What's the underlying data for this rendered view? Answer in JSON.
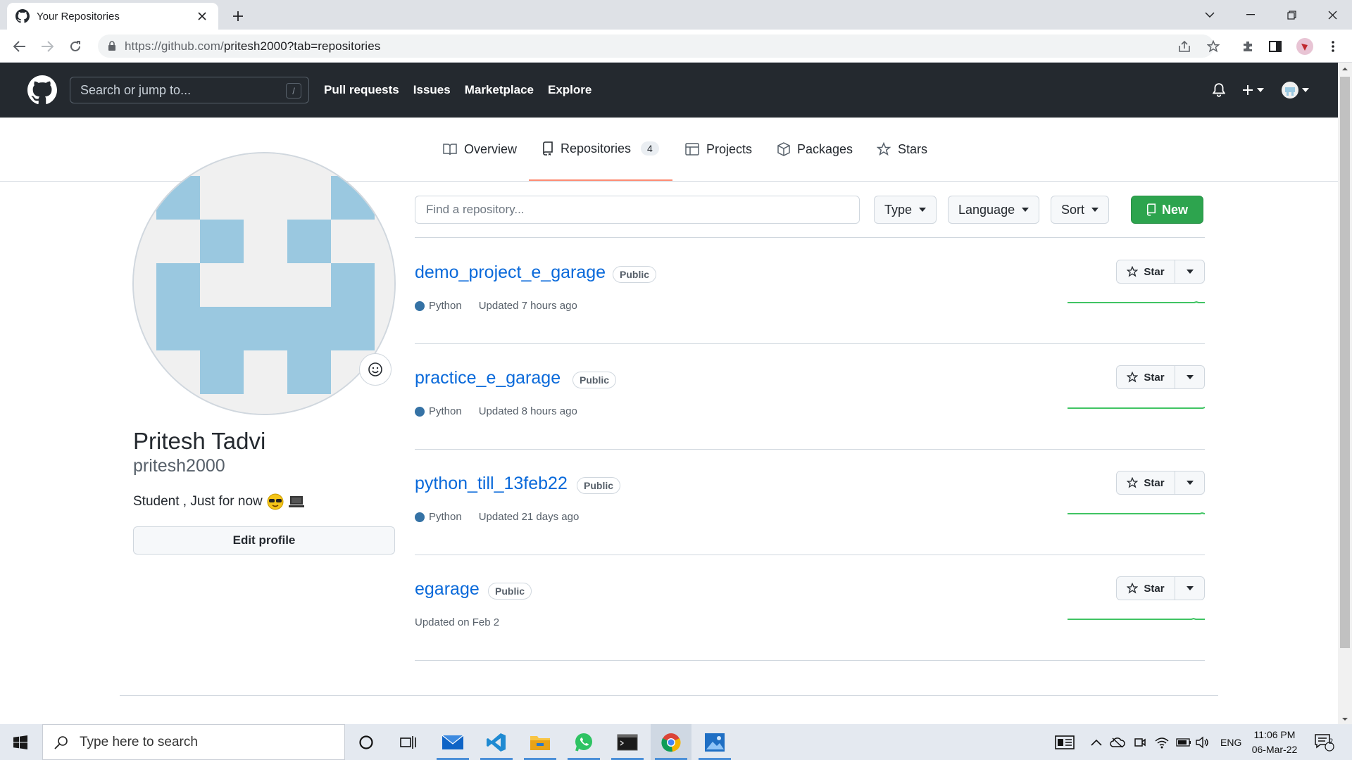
{
  "browser": {
    "tab_title": "Your Repositories",
    "url_host": "https://github.com/",
    "url_path": "pritesh2000?tab=repositories"
  },
  "header": {
    "search_placeholder": "Search or jump to...",
    "search_shortcut": "/",
    "nav": [
      "Pull requests",
      "Issues",
      "Marketplace",
      "Explore"
    ]
  },
  "profile_tabs": {
    "overview": "Overview",
    "repositories": "Repositories",
    "repositories_count": "4",
    "projects": "Projects",
    "packages": "Packages",
    "stars": "Stars"
  },
  "profile": {
    "name": "Pritesh Tadvi",
    "login": "pritesh2000",
    "bio": "Student , Just for now",
    "edit_button": "Edit profile"
  },
  "filters": {
    "find_placeholder": "Find a repository...",
    "type": "Type",
    "language": "Language",
    "sort": "Sort",
    "new": "New"
  },
  "repos": [
    {
      "name": "demo_project_e_garage",
      "visibility": "Public",
      "language": "Python",
      "updated": "Updated 7 hours ago",
      "star": "Star"
    },
    {
      "name": "practice_e_garage",
      "visibility": "Public",
      "language": "Python",
      "updated": "Updated 8 hours ago",
      "star": "Star"
    },
    {
      "name": "python_till_13feb22",
      "visibility": "Public",
      "language": "Python",
      "updated": "Updated 21 days ago",
      "star": "Star"
    },
    {
      "name": "egarage",
      "visibility": "Public",
      "language": "",
      "updated": "Updated on Feb 2",
      "star": "Star"
    }
  ],
  "colors": {
    "accent_blue": "#0969da",
    "new_green": "#2da44e",
    "python": "#3572A5",
    "tab_underline": "#fd8c73",
    "header_bg": "#24292f"
  },
  "taskbar": {
    "search_placeholder": "Type here to search",
    "language": "ENG",
    "time": "11:06 PM",
    "date": "06-Mar-22",
    "notification_count": "2"
  }
}
